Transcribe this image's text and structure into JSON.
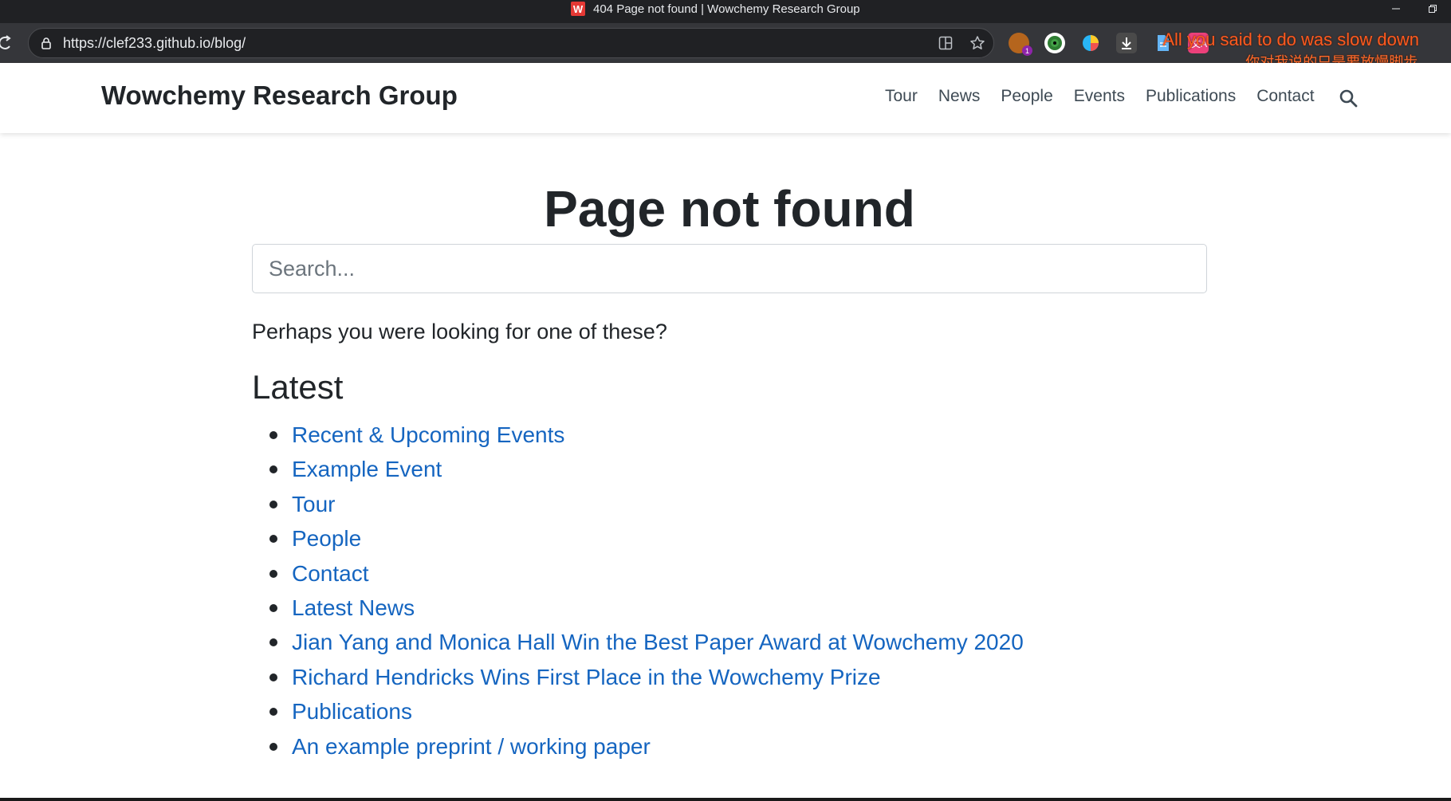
{
  "window": {
    "title": "404 Page not found | Wowchemy Research Group",
    "favicon_letter": "W"
  },
  "browser": {
    "url": "https://clef233.github.io/blog/",
    "extensions": [
      {
        "icon": "extension-cookie-icon",
        "badge": "1"
      },
      {
        "icon": "extension-globe-icon"
      },
      {
        "icon": "extension-color-icon"
      },
      {
        "icon": "extension-download-icon"
      },
      {
        "icon": "extension-doc-icon"
      },
      {
        "icon": "extension-translate-icon"
      }
    ]
  },
  "overlay": {
    "lyric_en": "All you said to do was slow down",
    "lyric_zh": "你对我说的只是要放慢脚步."
  },
  "site": {
    "brand": "Wowchemy Research Group",
    "nav": [
      "Tour",
      "News",
      "People",
      "Events",
      "Publications",
      "Contact"
    ]
  },
  "main": {
    "title": "Page not found",
    "search_placeholder": "Search...",
    "perhaps": "Perhaps you were looking for one of these?",
    "latest_heading": "Latest",
    "latest_links": [
      "Recent & Upcoming Events",
      "Example Event",
      "Tour",
      "People",
      "Contact",
      "Latest News",
      "Jian Yang and Monica Hall Win the Best Paper Award at Wowchemy 2020",
      "Richard Hendricks Wins First Place in the Wowchemy Prize",
      "Publications",
      "An example preprint / working paper"
    ]
  },
  "colors": {
    "link": "#1565c0",
    "text": "#212529",
    "lyric": "#ff5a1f"
  }
}
